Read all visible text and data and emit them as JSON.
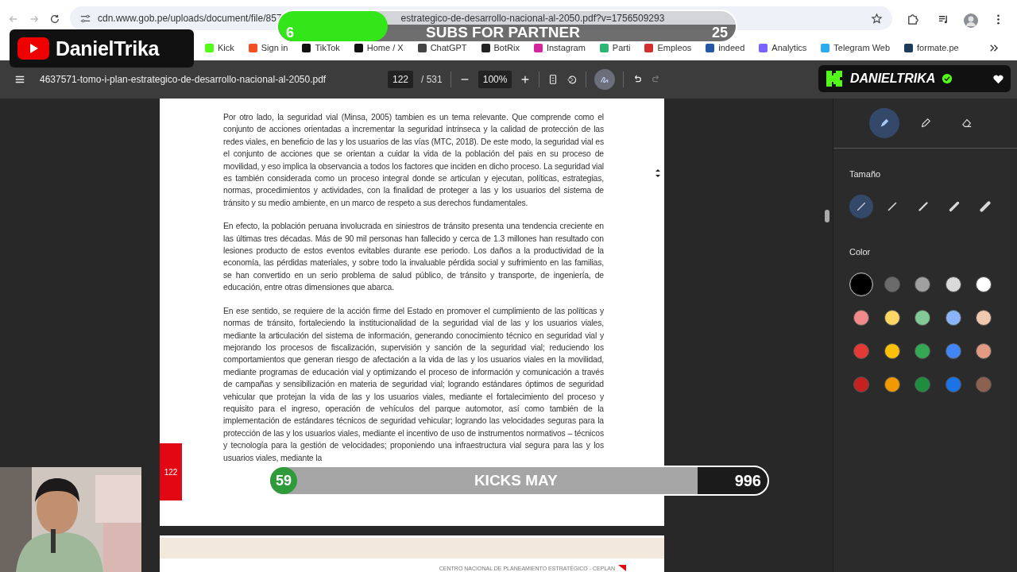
{
  "browser": {
    "url": "cdn.www.gob.pe/uploads/document/file/857",
    "url_tail": "estrategico-de-desarrollo-nacional-al-2050.pdf?v=1756509293",
    "bookmarks": [
      {
        "label": "Kick",
        "kind": "kick"
      },
      {
        "label": "Sign in",
        "kind": "ms"
      },
      {
        "label": "TikTok",
        "kind": "tiktok"
      },
      {
        "label": "Home / X",
        "kind": "x"
      },
      {
        "label": "ChatGPT",
        "kind": "gpt"
      },
      {
        "label": "BotRix",
        "kind": "bot"
      },
      {
        "label": "Instagram",
        "kind": "ig"
      },
      {
        "label": "Parti",
        "kind": "parti"
      },
      {
        "label": "Empleos",
        "kind": "empleos"
      },
      {
        "label": "indeed",
        "kind": "indeed"
      },
      {
        "label": "Analytics",
        "kind": "analytics"
      },
      {
        "label": "Telegram Web",
        "kind": "telegram"
      },
      {
        "label": "formate.pe",
        "kind": "formate"
      }
    ]
  },
  "pdf_toolbar": {
    "filename": "4637571-tomo-i-plan-estrategico-de-desarrollo-nacional-al-2050.pdf",
    "page": "122",
    "total": "/ 531",
    "zoom": "100%",
    "annotate_on": true
  },
  "page": {
    "paragraphs": [
      "Por otro lado, la seguridad vial (Minsa, 2005) tambien es un tema relevante. Que comprende como el conjunto de acciones orientadas a incrementar la seguridad intrinseca y la calidad de protección de las redes viales, en beneficio de las y los usuarios de las vías (MTC, 2018). De este modo, la seguridad vial es el conjunto de acciones que se orientan a cuidar la vida de la población del pais en su proceso de movilidad, y eso implica la observancia a todos los factores que inciden en dicho proceso. La seguridad vial es también considerada como un proceso integral donde se articulan y ejecutan, políticas, estrategias, normas, procedimientos y actividades, con la finalidad de proteger a las y los usuarios del sistema de tránsito y su medio ambiente, en un marco de respeto a sus derechos fundamentales.",
      "En efecto, la población peruana involucrada en siniestros de tránsito presenta una tendencia creciente en las últimas tres décadas. Más de 90 mil personas han fallecido y cerca de 1.3 millones han resultado con lesiones producto de estos eventos evitables durante ese periodo. Los daños a la productividad de la economía, las pérdidas materiales, y sobre todo la invaluable pérdida social y sufrimiento en las familias, se han convertido en un serio problema de salud público, de tránsito y transporte, de ingeniería, de educación, entre otras dimensiones que abarca.",
      "En ese sentido, se requiere de la acción firme del Estado en promover el cumplimiento de las políticas y normas de tránsito, fortaleciendo la institucionalidad de la seguridad vial de las y los usuarios viales, mediante la articulación del sistema de información, generando conocimiento técnico en seguridad vial y mejorando los procesos de fiscalización, supervisión y sanción de la seguridad vial; reduciendo los comportamientos que generan riesgo de afectación a la vida de las y los usuarios viales en la movilidad, mediante programas de educación vial y optimizando el proceso de información y comunicación a través de campañas y sensibilización en materia de seguridad vial; logrando estándares óptimos de seguridad vehicular que protejan la vida de las y los usuarios viales, mediante el fortalecimiento del proceso y requisito para el ingreso, operación de vehículos del parque automotor, así como también de la implementación de estándares técnicos de seguridad vehicular; logrando las velocidades seguras para la protección de las y los usuarios viales, mediante el incentivo de uso de instrumentos normativos – técnicos y tecnología para la gestión de velocidades; proponiendo una infraestructura vial segura para las y los usuarios viales, mediante la"
    ],
    "page_number": "122",
    "next_footer": "CENTRO NACIONAL DE PLANEAMIENTO ESTRATÉGICO - CEPLAN"
  },
  "annotation_panel": {
    "tools": [
      {
        "kind": "pen",
        "selected": true
      },
      {
        "kind": "highlighter",
        "selected": false
      },
      {
        "kind": "eraser",
        "selected": false
      }
    ],
    "size_label": "Tamaño",
    "sizes": [
      {
        "selected": true
      },
      {
        "selected": false
      },
      {
        "selected": false
      },
      {
        "selected": false
      },
      {
        "selected": false
      }
    ],
    "color_label": "Color",
    "colors": [
      {
        "color": "#000000",
        "selected": true
      },
      {
        "color": "#6b6b6b",
        "selected": false
      },
      {
        "color": "#a0a0a0",
        "selected": false
      },
      {
        "color": "#dadada",
        "selected": false
      },
      {
        "color": "#ffffff",
        "selected": false
      },
      {
        "color": "#f08a8a",
        "selected": false
      },
      {
        "color": "#fdd663",
        "selected": false
      },
      {
        "color": "#81c995",
        "selected": false
      },
      {
        "color": "#8ab4f8",
        "selected": false
      },
      {
        "color": "#f0c8ad",
        "selected": false
      },
      {
        "color": "#e53935",
        "selected": false
      },
      {
        "color": "#f9c10a",
        "selected": false
      },
      {
        "color": "#34a853",
        "selected": false
      },
      {
        "color": "#4285f4",
        "selected": false
      },
      {
        "color": "#e39a85",
        "selected": false
      },
      {
        "color": "#c5221f",
        "selected": false
      },
      {
        "color": "#f29900",
        "selected": false
      },
      {
        "color": "#1e8e3e",
        "selected": false
      },
      {
        "color": "#1a73e8",
        "selected": false
      },
      {
        "color": "#8d6150",
        "selected": false
      }
    ]
  },
  "overlays": {
    "youtube_badge": {
      "name": "DanielTrika"
    },
    "subs_goal": {
      "current": "6",
      "label": "SUBS FOR PARTNER",
      "target": "25",
      "level": 0.24
    },
    "kick_badge": {
      "name": "DANIELTRIKA",
      "verified": true
    },
    "kicks_goal": {
      "current": "59",
      "label": "KICKS MAY",
      "target": "996"
    }
  }
}
